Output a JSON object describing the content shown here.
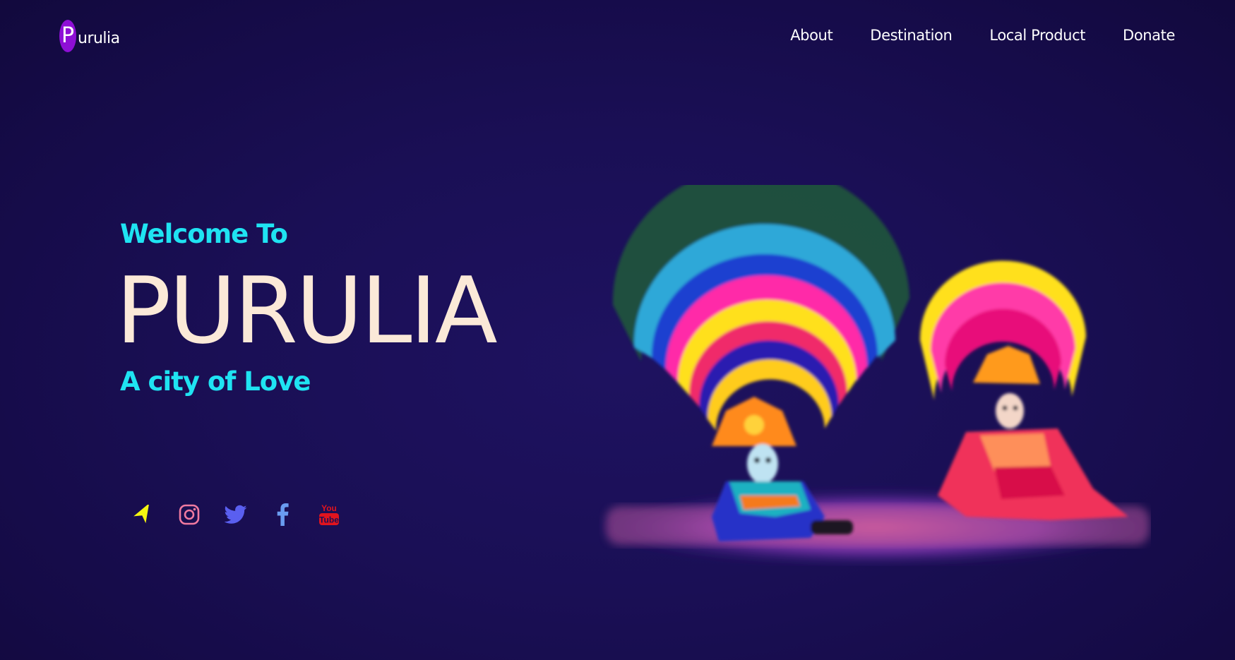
{
  "logo": {
    "initial": "P",
    "rest": "urulia"
  },
  "nav": {
    "items": [
      {
        "label": "About"
      },
      {
        "label": "Destination"
      },
      {
        "label": "Local Product"
      },
      {
        "label": "Donate"
      }
    ]
  },
  "hero": {
    "welcome": "Welcome To",
    "title": "PURULIA",
    "tagline": "A city of Love"
  },
  "social": {
    "icons": [
      "location-arrow-icon",
      "instagram-icon",
      "twitter-icon",
      "facebook-icon",
      "youtube-icon"
    ],
    "youtube_text_top": "You",
    "youtube_text_bottom": "Tube"
  },
  "colors": {
    "background": "#1a0f55",
    "accent_cyan": "#1fe3f2",
    "title_cream": "#fbe9d8",
    "logo_purple": "#8e0fd6",
    "arrow_yellow": "#f5f511",
    "instagram_pink": "#f07aa0",
    "twitter_blue": "#5a5ff0",
    "facebook_blue": "#6a9cf0",
    "youtube_red": "#e0141e"
  },
  "image": {
    "subject": "chhau-dancers-image"
  }
}
